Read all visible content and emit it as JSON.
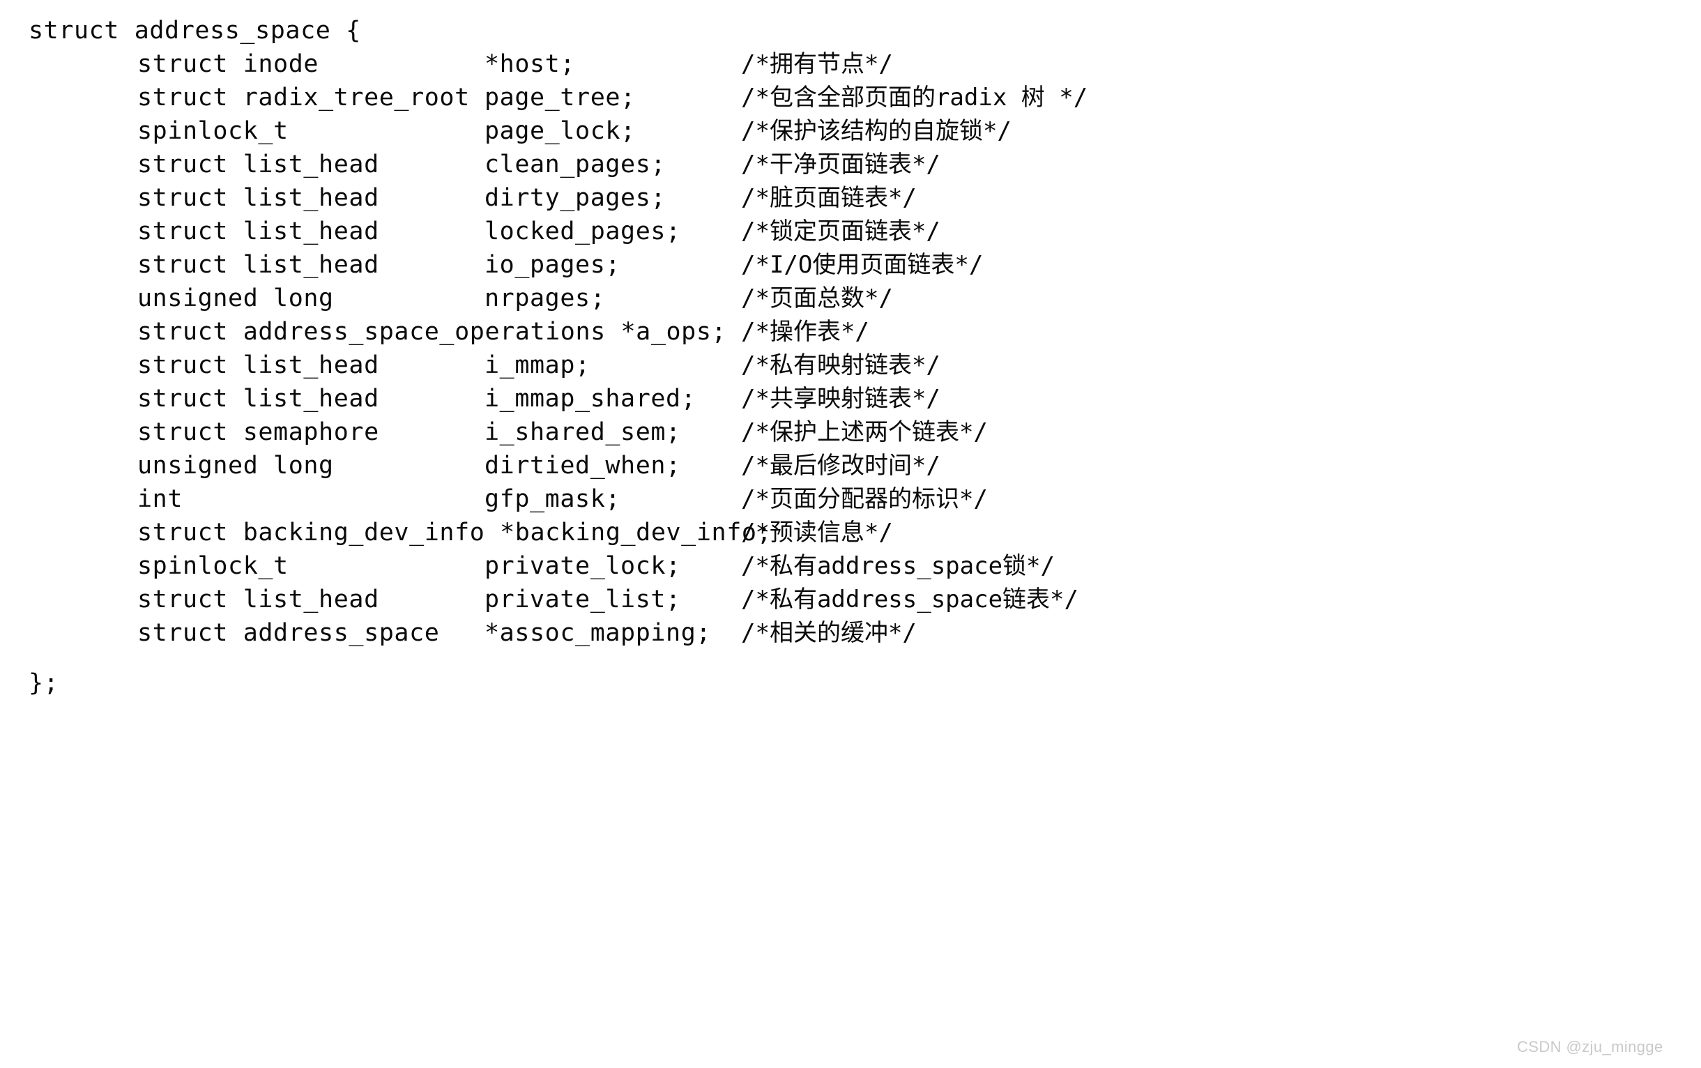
{
  "document": {
    "kind": "c-source-listing",
    "language": "C",
    "background_color": "#ffffff",
    "text_color": "#0b0b0b",
    "opening_line": "struct address_space {",
    "closing_line": "};",
    "watermark": "CSDN @zju_mingge",
    "watermark_color": "#c9c9c9"
  },
  "fields": [
    {
      "type": "struct inode",
      "name": "*host;",
      "comment": "/*拥有节点*/",
      "spans_columns": false
    },
    {
      "type": "struct radix_tree_root",
      "name": "page_tree;",
      "comment": "/*包含全部页面的radix 树 */",
      "spans_columns": false
    },
    {
      "type": "spinlock_t",
      "name": "page_lock;",
      "comment": "/*保护该结构的自旋锁*/",
      "spans_columns": false
    },
    {
      "type": "struct list_head",
      "name": "clean_pages;",
      "comment": "/*干净页面链表*/",
      "spans_columns": false
    },
    {
      "type": "struct list_head",
      "name": "dirty_pages;",
      "comment": "/*脏页面链表*/",
      "spans_columns": false
    },
    {
      "type": "struct list_head",
      "name": "locked_pages;",
      "comment": "/*锁定页面链表*/",
      "spans_columns": false
    },
    {
      "type": "struct list_head",
      "name": "io_pages;",
      "comment": "/*I/O使用页面链表*/",
      "spans_columns": false
    },
    {
      "type": "unsigned long",
      "name": "nrpages;",
      "comment": "/*页面总数*/",
      "spans_columns": false
    },
    {
      "type": "struct address_space_operations *a_ops;",
      "name": "",
      "comment": "/*操作表*/",
      "spans_columns": true
    },
    {
      "type": "struct list_head",
      "name": "i_mmap;",
      "comment": "/*私有映射链表*/",
      "spans_columns": false
    },
    {
      "type": "struct list_head",
      "name": "i_mmap_shared;",
      "comment": "/*共享映射链表*/",
      "spans_columns": false
    },
    {
      "type": "struct semaphore",
      "name": "i_shared_sem;",
      "comment": "/*保护上述两个链表*/",
      "spans_columns": false
    },
    {
      "type": "unsigned long",
      "name": "dirtied_when;",
      "comment": "/*最后修改时间*/",
      "spans_columns": false
    },
    {
      "type": "int",
      "name": "gfp_mask;",
      "comment": "/*页面分配器的标识*/",
      "spans_columns": false
    },
    {
      "type": "struct backing_dev_info *backing_dev_info;",
      "name": "",
      "comment": "/*预读信息*/",
      "spans_columns": true
    },
    {
      "type": "spinlock_t",
      "name": "private_lock;",
      "comment": "/*私有address_space锁*/",
      "spans_columns": false
    },
    {
      "type": "struct list_head",
      "name": "private_list;",
      "comment": "/*私有address_space链表*/",
      "spans_columns": false
    },
    {
      "type": "struct address_space",
      "name": "*assoc_mapping;",
      "comment": "/*相关的缓冲*/",
      "spans_columns": false
    }
  ]
}
